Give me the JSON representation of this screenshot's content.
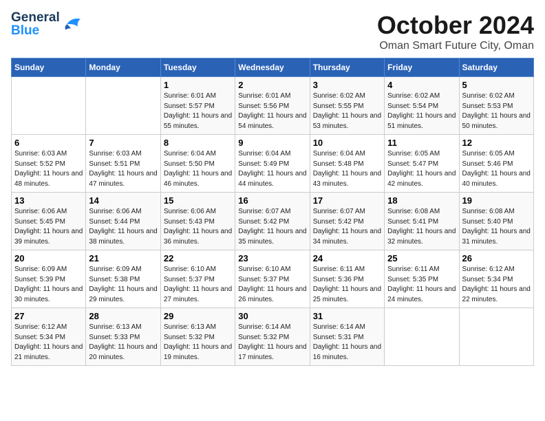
{
  "logo": {
    "general": "General",
    "blue": "Blue"
  },
  "header": {
    "month_year": "October 2024",
    "location": "Oman Smart Future City, Oman"
  },
  "days_of_week": [
    "Sunday",
    "Monday",
    "Tuesday",
    "Wednesday",
    "Thursday",
    "Friday",
    "Saturday"
  ],
  "weeks": [
    [
      {
        "day": "",
        "info": ""
      },
      {
        "day": "",
        "info": ""
      },
      {
        "day": "1",
        "info": "Sunrise: 6:01 AM\nSunset: 5:57 PM\nDaylight: 11 hours and 55 minutes."
      },
      {
        "day": "2",
        "info": "Sunrise: 6:01 AM\nSunset: 5:56 PM\nDaylight: 11 hours and 54 minutes."
      },
      {
        "day": "3",
        "info": "Sunrise: 6:02 AM\nSunset: 5:55 PM\nDaylight: 11 hours and 53 minutes."
      },
      {
        "day": "4",
        "info": "Sunrise: 6:02 AM\nSunset: 5:54 PM\nDaylight: 11 hours and 51 minutes."
      },
      {
        "day": "5",
        "info": "Sunrise: 6:02 AM\nSunset: 5:53 PM\nDaylight: 11 hours and 50 minutes."
      }
    ],
    [
      {
        "day": "6",
        "info": "Sunrise: 6:03 AM\nSunset: 5:52 PM\nDaylight: 11 hours and 48 minutes."
      },
      {
        "day": "7",
        "info": "Sunrise: 6:03 AM\nSunset: 5:51 PM\nDaylight: 11 hours and 47 minutes."
      },
      {
        "day": "8",
        "info": "Sunrise: 6:04 AM\nSunset: 5:50 PM\nDaylight: 11 hours and 46 minutes."
      },
      {
        "day": "9",
        "info": "Sunrise: 6:04 AM\nSunset: 5:49 PM\nDaylight: 11 hours and 44 minutes."
      },
      {
        "day": "10",
        "info": "Sunrise: 6:04 AM\nSunset: 5:48 PM\nDaylight: 11 hours and 43 minutes."
      },
      {
        "day": "11",
        "info": "Sunrise: 6:05 AM\nSunset: 5:47 PM\nDaylight: 11 hours and 42 minutes."
      },
      {
        "day": "12",
        "info": "Sunrise: 6:05 AM\nSunset: 5:46 PM\nDaylight: 11 hours and 40 minutes."
      }
    ],
    [
      {
        "day": "13",
        "info": "Sunrise: 6:06 AM\nSunset: 5:45 PM\nDaylight: 11 hours and 39 minutes."
      },
      {
        "day": "14",
        "info": "Sunrise: 6:06 AM\nSunset: 5:44 PM\nDaylight: 11 hours and 38 minutes."
      },
      {
        "day": "15",
        "info": "Sunrise: 6:06 AM\nSunset: 5:43 PM\nDaylight: 11 hours and 36 minutes."
      },
      {
        "day": "16",
        "info": "Sunrise: 6:07 AM\nSunset: 5:42 PM\nDaylight: 11 hours and 35 minutes."
      },
      {
        "day": "17",
        "info": "Sunrise: 6:07 AM\nSunset: 5:42 PM\nDaylight: 11 hours and 34 minutes."
      },
      {
        "day": "18",
        "info": "Sunrise: 6:08 AM\nSunset: 5:41 PM\nDaylight: 11 hours and 32 minutes."
      },
      {
        "day": "19",
        "info": "Sunrise: 6:08 AM\nSunset: 5:40 PM\nDaylight: 11 hours and 31 minutes."
      }
    ],
    [
      {
        "day": "20",
        "info": "Sunrise: 6:09 AM\nSunset: 5:39 PM\nDaylight: 11 hours and 30 minutes."
      },
      {
        "day": "21",
        "info": "Sunrise: 6:09 AM\nSunset: 5:38 PM\nDaylight: 11 hours and 29 minutes."
      },
      {
        "day": "22",
        "info": "Sunrise: 6:10 AM\nSunset: 5:37 PM\nDaylight: 11 hours and 27 minutes."
      },
      {
        "day": "23",
        "info": "Sunrise: 6:10 AM\nSunset: 5:37 PM\nDaylight: 11 hours and 26 minutes."
      },
      {
        "day": "24",
        "info": "Sunrise: 6:11 AM\nSunset: 5:36 PM\nDaylight: 11 hours and 25 minutes."
      },
      {
        "day": "25",
        "info": "Sunrise: 6:11 AM\nSunset: 5:35 PM\nDaylight: 11 hours and 24 minutes."
      },
      {
        "day": "26",
        "info": "Sunrise: 6:12 AM\nSunset: 5:34 PM\nDaylight: 11 hours and 22 minutes."
      }
    ],
    [
      {
        "day": "27",
        "info": "Sunrise: 6:12 AM\nSunset: 5:34 PM\nDaylight: 11 hours and 21 minutes."
      },
      {
        "day": "28",
        "info": "Sunrise: 6:13 AM\nSunset: 5:33 PM\nDaylight: 11 hours and 20 minutes."
      },
      {
        "day": "29",
        "info": "Sunrise: 6:13 AM\nSunset: 5:32 PM\nDaylight: 11 hours and 19 minutes."
      },
      {
        "day": "30",
        "info": "Sunrise: 6:14 AM\nSunset: 5:32 PM\nDaylight: 11 hours and 17 minutes."
      },
      {
        "day": "31",
        "info": "Sunrise: 6:14 AM\nSunset: 5:31 PM\nDaylight: 11 hours and 16 minutes."
      },
      {
        "day": "",
        "info": ""
      },
      {
        "day": "",
        "info": ""
      }
    ]
  ]
}
